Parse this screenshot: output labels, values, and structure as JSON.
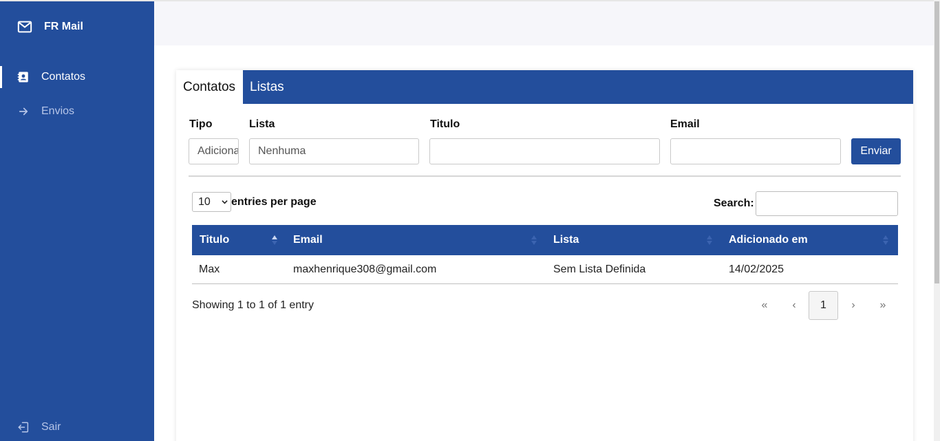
{
  "app": {
    "name": "FR Mail"
  },
  "sidebar": {
    "items": [
      {
        "label": "Contatos",
        "icon": "contact-card-icon",
        "active": true
      },
      {
        "label": "Envios",
        "icon": "arrow-right-icon",
        "active": false
      }
    ],
    "logout": {
      "label": "Sair",
      "icon": "logout-icon"
    }
  },
  "tabs": [
    {
      "label": "Contatos",
      "active": true
    },
    {
      "label": "Listas",
      "active": false
    }
  ],
  "form": {
    "tipo": {
      "label": "Tipo",
      "value": "Adicionar"
    },
    "lista": {
      "label": "Lista",
      "value": "Nenhuma"
    },
    "titulo": {
      "label": "Titulo",
      "value": ""
    },
    "email": {
      "label": "Email",
      "value": ""
    },
    "submit_label": "Enviar"
  },
  "table_controls": {
    "entries_value": "10",
    "entries_label": "entries per page",
    "search_label": "Search:",
    "search_value": ""
  },
  "table": {
    "columns": [
      "Titulo",
      "Email",
      "Lista",
      "Adicionado em"
    ],
    "rows": [
      [
        "Max",
        "maxhenrique308@gmail.com",
        "Sem Lista Definida",
        "14/02/2025"
      ]
    ]
  },
  "pagination": {
    "info": "Showing 1 to 1 of 1 entry",
    "first": "«",
    "prev": "‹",
    "current": "1",
    "next": "›",
    "last": "»"
  },
  "colors": {
    "primary": "#234e9c",
    "muted_nav": "#b6c5e8",
    "top_band": "#f6f6fa"
  }
}
